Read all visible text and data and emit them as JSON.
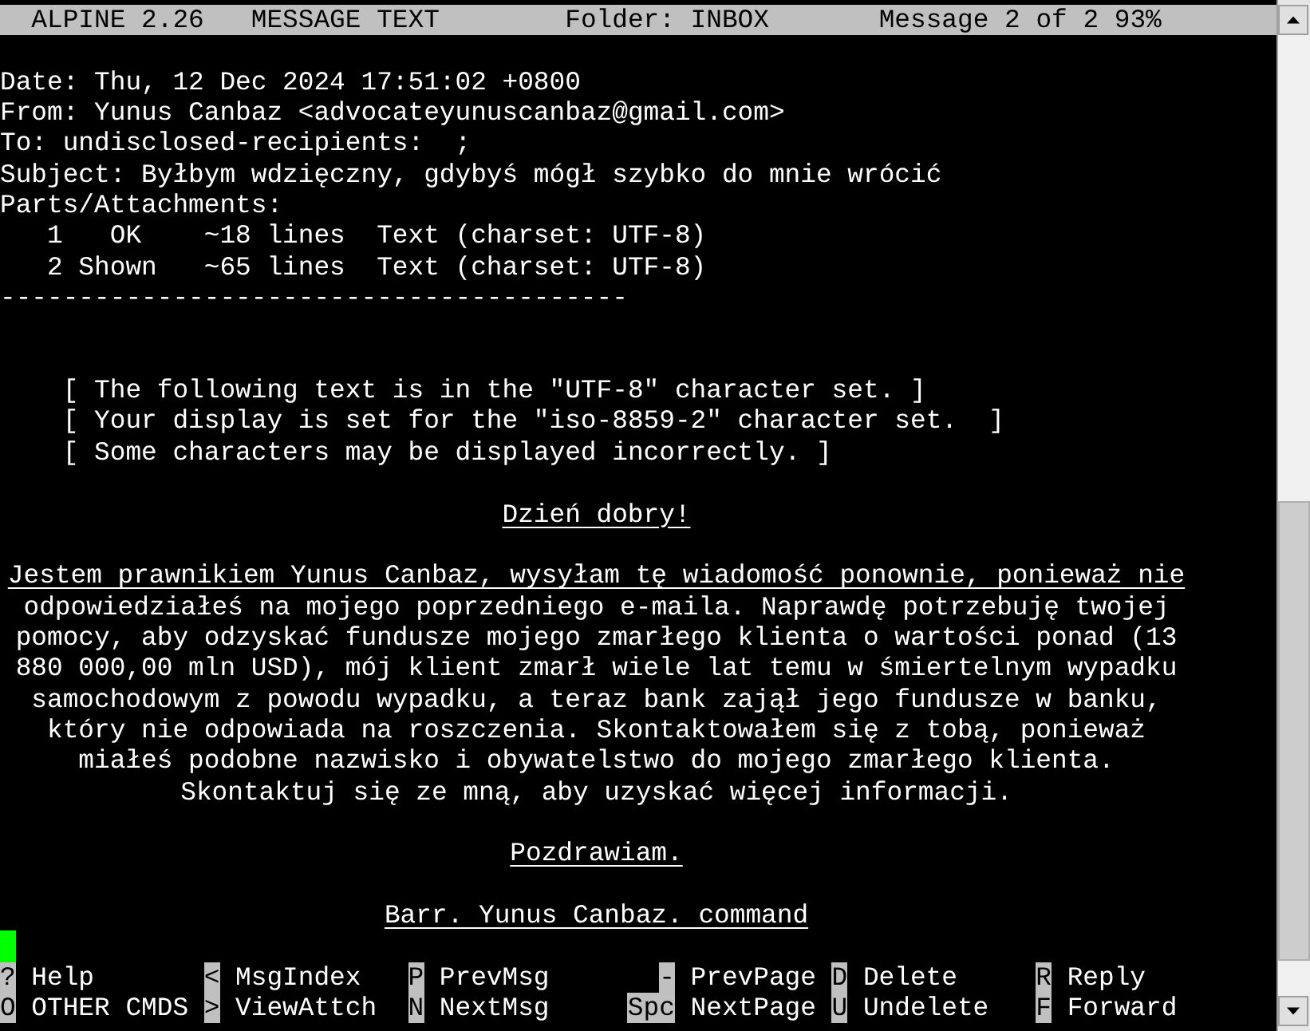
{
  "title_bar": {
    "app": "ALPINE 2.26",
    "screen": "MESSAGE TEXT",
    "folder": "Folder: INBOX",
    "position": "Message 2 of 2 93%"
  },
  "lines": [
    {
      "kind": "blank"
    },
    {
      "kind": "header",
      "text": "Date: Thu, 12 Dec 2024 17:51:02 +0800"
    },
    {
      "kind": "header",
      "text": "From: Yunus Canbaz <advocateyunuscanbaz@gmail.com>"
    },
    {
      "kind": "header",
      "text": "To: undisclosed-recipients:  ;"
    },
    {
      "kind": "header",
      "text": "Subject: Byłbym wdzięczny, gdybyś mógł szybko do mnie wrócić"
    },
    {
      "kind": "header",
      "text": "Parts/Attachments:"
    },
    {
      "kind": "header",
      "text": "   1   OK    ~18 lines  Text (charset: UTF-8)"
    },
    {
      "kind": "header",
      "text": "   2 Shown   ~65 lines  Text (charset: UTF-8)"
    },
    {
      "kind": "rule",
      "text": "----------------------------------------"
    },
    {
      "kind": "blank"
    },
    {
      "kind": "blank"
    },
    {
      "kind": "notice",
      "text": "    [ The following text is in the \"UTF-8\" character set. ]"
    },
    {
      "kind": "notice",
      "text": "    [ Your display is set for the \"iso-8859-2\" character set.  ]"
    },
    {
      "kind": "notice",
      "text": "    [ Some characters may be displayed incorrectly. ]"
    },
    {
      "kind": "blank"
    },
    {
      "kind": "body",
      "text": "Dzień dobry!",
      "link": true
    },
    {
      "kind": "blank"
    },
    {
      "kind": "body",
      "text": "Jestem prawnikiem Yunus Canbaz, wysyłam tę wiadomość ponownie, ponieważ nie",
      "link": true
    },
    {
      "kind": "body",
      "text": "odpowiedziałeś na mojego poprzedniego e-maila. Naprawdę potrzebuję twojej",
      "link": false
    },
    {
      "kind": "body",
      "text": "pomocy, aby odzyskać fundusze mojego zmarłego klienta o wartości ponad (13",
      "link": false
    },
    {
      "kind": "body",
      "text": "880 000,00 mln USD), mój klient zmarł wiele lat temu w śmiertelnym wypadku",
      "link": false
    },
    {
      "kind": "body",
      "text": "samochodowym z powodu wypadku, a teraz bank zajął jego fundusze w banku,",
      "link": false
    },
    {
      "kind": "body",
      "text": "który nie odpowiada na roszczenia. Skontaktowałem się z tobą, ponieważ",
      "link": false
    },
    {
      "kind": "body",
      "text": "miałeś podobne nazwisko i obywatelstwo do mojego zmarłego klienta.",
      "link": false
    },
    {
      "kind": "body",
      "text": "Skontaktuj się ze mną, aby uzyskać więcej informacji.",
      "link": false
    },
    {
      "kind": "blank"
    },
    {
      "kind": "body",
      "text": "Pozdrawiam.",
      "link": true
    },
    {
      "kind": "blank"
    },
    {
      "kind": "body",
      "text": "Barr. Yunus Canbaz. command",
      "link": true
    },
    {
      "kind": "cursor"
    }
  ],
  "commands": [
    [
      {
        "key": "?",
        "label": "Help"
      },
      {
        "key": "O",
        "label": "OTHER CMDS"
      }
    ],
    [
      {
        "key": "<",
        "label": "MsgIndex"
      },
      {
        "key": ">",
        "label": "ViewAttch"
      }
    ],
    [
      {
        "key": "P",
        "label": "PrevMsg"
      },
      {
        "key": "N",
        "label": "NextMsg"
      }
    ],
    [
      {
        "key": "-",
        "label": "PrevPage"
      },
      {
        "key": "Spc",
        "label": "NextPage"
      }
    ],
    [
      {
        "key": "D",
        "label": "Delete"
      },
      {
        "key": "U",
        "label": "Undelete"
      }
    ],
    [
      {
        "key": "R",
        "label": "Reply"
      },
      {
        "key": "F",
        "label": "Forward"
      }
    ]
  ]
}
